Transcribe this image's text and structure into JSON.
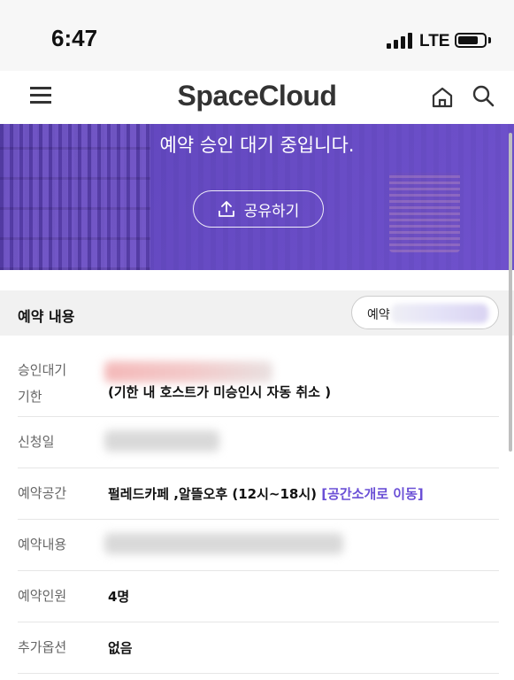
{
  "status_bar": {
    "time": "6:47",
    "network": "LTE"
  },
  "header": {
    "logo": "SpaceCloud"
  },
  "hero": {
    "title": "예약 승인 대기 중입니다.",
    "share_label": "공유하기"
  },
  "section": {
    "title": "예약 내용",
    "reserve_button_prefix": "예약"
  },
  "rows": [
    {
      "label_line1": "승인대기",
      "label_line2": "기한",
      "value": "(기한 내 호스트가 미승인시 자동 취소 )"
    },
    {
      "label": "신청일",
      "value": ""
    },
    {
      "label": "예약공간",
      "value": "펄레드카페 ,알뜰오후 (12시~18시)",
      "link": "[공간소개로 이동]"
    },
    {
      "label": "예약내용",
      "value": ""
    },
    {
      "label": "예약인원",
      "value": "4명"
    },
    {
      "label": "추가옵션",
      "value": "없음"
    }
  ],
  "colors": {
    "hero": "#6b4fd0",
    "link": "#6a4fd6"
  }
}
